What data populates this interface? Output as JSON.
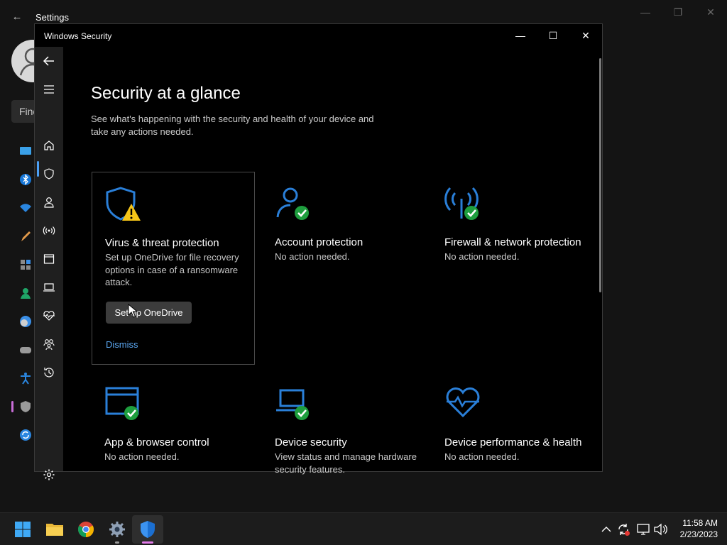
{
  "settings_window": {
    "title": "Settings",
    "back_glyph": "←",
    "minimize_glyph": "—",
    "maximize_glyph": "❐",
    "close_glyph": "✕",
    "search_text": "Find"
  },
  "security_window": {
    "title": "Windows Security",
    "minimize_glyph": "—",
    "maximize_glyph": "☐",
    "close_glyph": "✕"
  },
  "nav": {
    "items": [
      {
        "name": "back-icon"
      },
      {
        "name": "menu-icon"
      },
      {
        "name": "home-icon",
        "selected": true
      },
      {
        "name": "shield-icon"
      },
      {
        "name": "account-icon"
      },
      {
        "name": "network-icon"
      },
      {
        "name": "app-browser-icon"
      },
      {
        "name": "laptop-icon"
      },
      {
        "name": "health-icon"
      },
      {
        "name": "family-icon"
      },
      {
        "name": "history-icon"
      },
      {
        "name": "settings-gear-icon"
      }
    ]
  },
  "page": {
    "title": "Security at a glance",
    "subtitle": "See what's happening with the security and health of your device and take any actions needed."
  },
  "tiles": [
    {
      "title": "Virus & threat protection",
      "desc": "Set up OneDrive for file recovery options in case of a ransomware attack.",
      "status": "warning",
      "button": "Set up OneDrive",
      "link": "Dismiss"
    },
    {
      "title": "Account protection",
      "desc": "No action needed.",
      "status": "ok"
    },
    {
      "title": "Firewall & network protection",
      "desc": "No action needed.",
      "status": "ok"
    },
    {
      "title": "App & browser control",
      "desc": "No action needed.",
      "status": "ok"
    },
    {
      "title": "Device security",
      "desc": "View status and manage hardware security features.",
      "status": "ok"
    },
    {
      "title": "Device performance & health",
      "desc": "No action needed.",
      "status": "ok"
    }
  ],
  "taskbar": {
    "apps": [
      "start-icon",
      "file-explorer-icon",
      "chrome-icon",
      "settings-icon",
      "windows-security-icon"
    ],
    "tray": {
      "chevron": "^",
      "volume": "🔊"
    },
    "time": "11:58 AM",
    "date": "2/23/2023"
  },
  "colors": {
    "accent_blue": "#2a7fd8",
    "ok_green": "#1e9e3e",
    "warn_yellow": "#f5c518",
    "link_blue": "#5aa6f0"
  }
}
